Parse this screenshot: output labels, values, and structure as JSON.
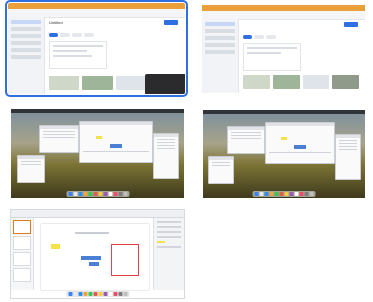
{
  "thumbnails": [
    {
      "title": "Untitled",
      "addr": "",
      "selected": true
    },
    {
      "title": "",
      "addr": "",
      "selected": false
    },
    {
      "title": "",
      "selected": false
    },
    {
      "title": "",
      "selected": false
    },
    {
      "title": "",
      "selected": false
    }
  ],
  "colors": {
    "selection_outline": "#2f6fe4",
    "titlebar_orange": "#e9a03b",
    "accent_blue": "#2f6fe4",
    "highlight_yellow": "#f5e24a"
  },
  "dock_icons": [
    "finder-icon",
    "launchpad-icon",
    "safari-icon",
    "mail-icon",
    "messages-icon",
    "maps-icon",
    "photos-icon",
    "calendar-icon",
    "notes-icon",
    "music-icon",
    "settings-icon",
    "trash-icon"
  ]
}
